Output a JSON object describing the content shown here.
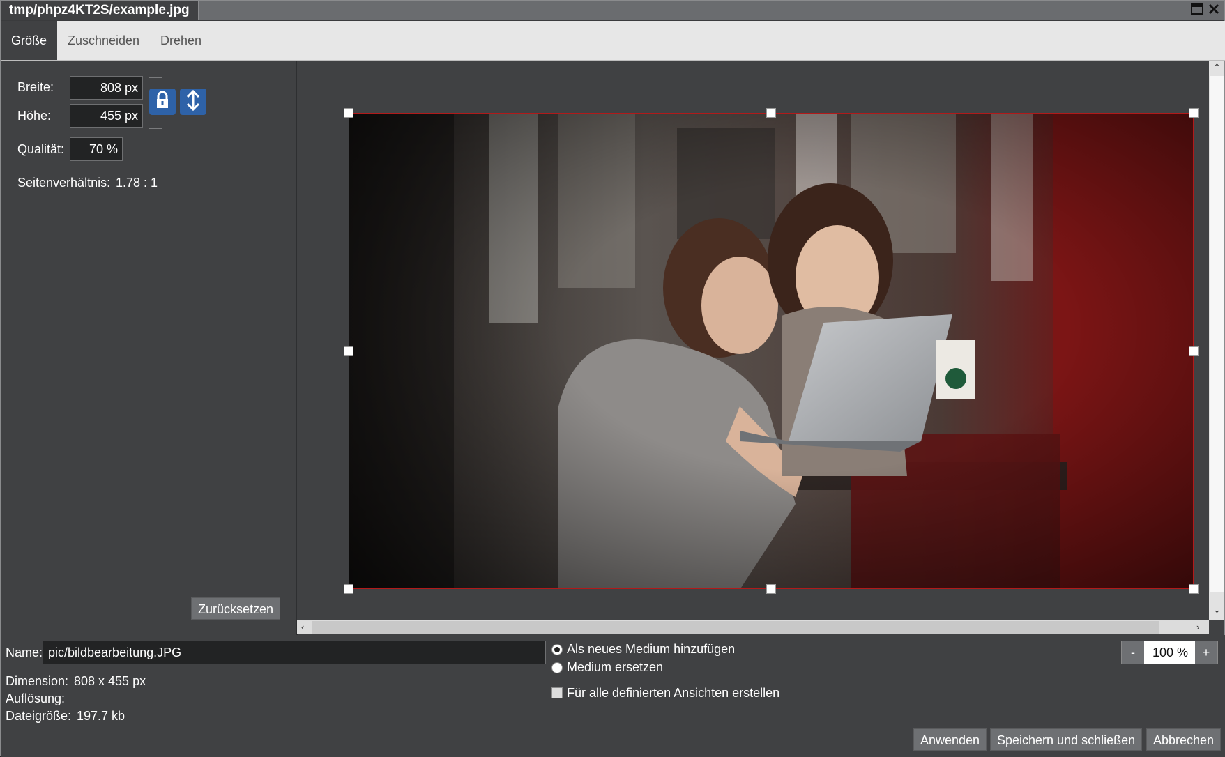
{
  "window": {
    "title": "tmp/phpz4KT2S/example.jpg"
  },
  "tabs": [
    {
      "label": "Größe",
      "active": true
    },
    {
      "label": "Zuschneiden",
      "active": false
    },
    {
      "label": "Drehen",
      "active": false
    }
  ],
  "size": {
    "width_label": "Breite:",
    "width_value": "808 px",
    "height_label": "Höhe:",
    "height_value": "455 px",
    "quality_label": "Qualität:",
    "quality_value": "70 %",
    "aspect_label": "Seitenverhältnis:",
    "aspect_value": "1.78 : 1",
    "reset_label": "Zurücksetzen"
  },
  "file": {
    "name_label": "Name:",
    "name_value": "pic/bildbearbeitung.JPG",
    "dimension_label": "Dimension:",
    "dimension_value": "808 x 455 px",
    "resolution_label": "Auflösung:",
    "resolution_value": "",
    "filesize_label": "Dateigröße:",
    "filesize_value": "197.7 kb"
  },
  "options": {
    "add_new_label": "Als neues Medium hinzufügen",
    "replace_label": "Medium ersetzen",
    "all_views_label": "Für alle definierten Ansichten erstellen"
  },
  "zoom": {
    "minus": "-",
    "value": "100 %",
    "plus": "+"
  },
  "actions": {
    "apply_label": "Anwenden",
    "save_close_label": "Speichern und schließen",
    "cancel_label": "Abbrechen"
  },
  "colors": {
    "accent_button": "#2e62a8",
    "selection_border": "#b11a1a"
  }
}
